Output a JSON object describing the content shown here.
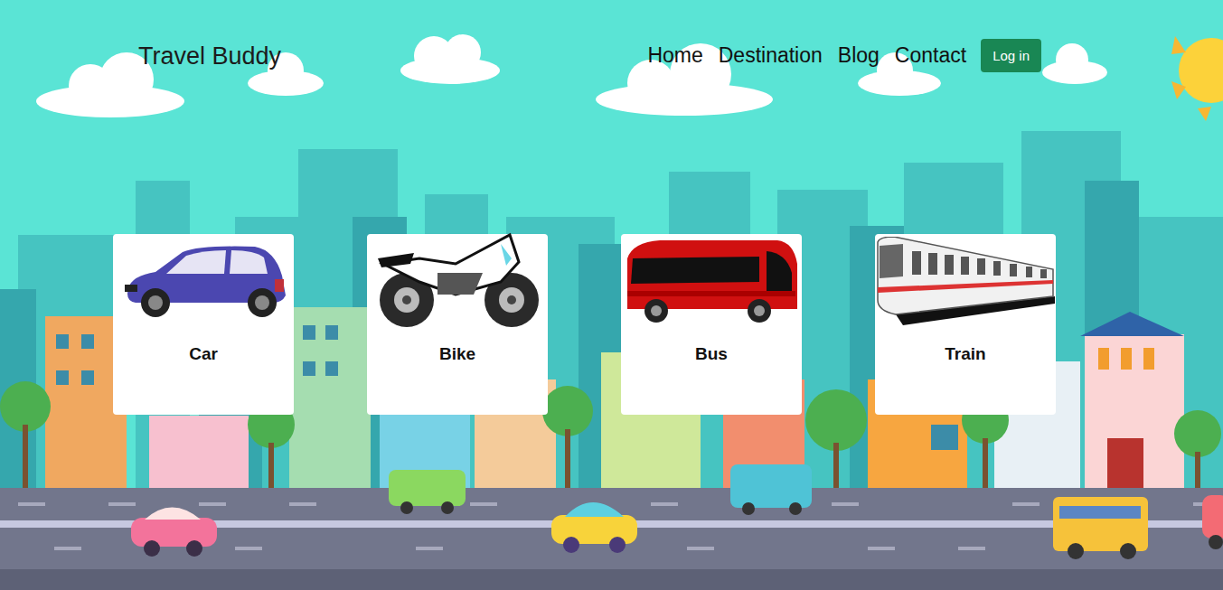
{
  "brand": "Travel Buddy",
  "nav": [
    {
      "label": "Home"
    },
    {
      "label": "Destination"
    },
    {
      "label": "Blog"
    },
    {
      "label": "Contact"
    }
  ],
  "login_button": "Log in",
  "cards": [
    {
      "label": "Car",
      "kind": "car"
    },
    {
      "label": "Bike",
      "kind": "bike"
    },
    {
      "label": "Bus",
      "kind": "bus"
    },
    {
      "label": "Train",
      "kind": "train"
    }
  ]
}
